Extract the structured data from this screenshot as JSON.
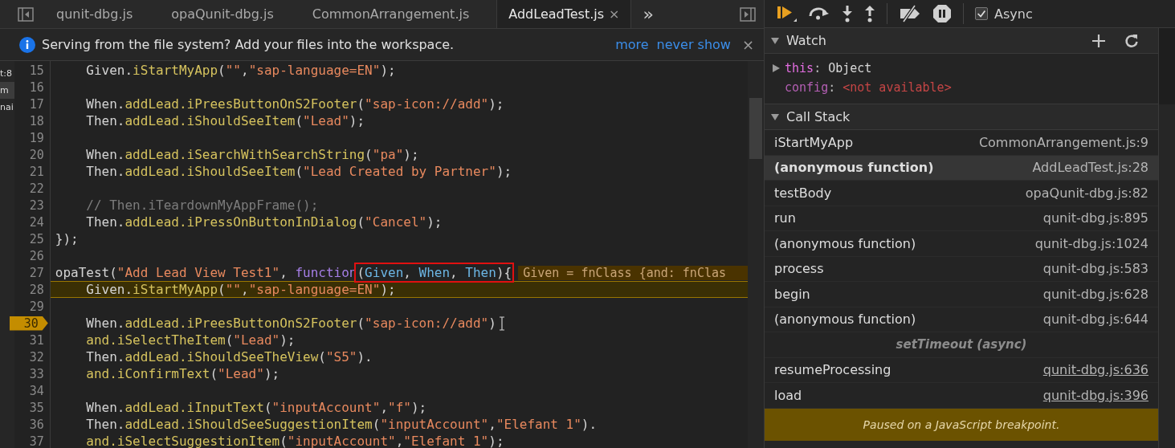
{
  "editor_tabs": [
    {
      "label": "qunit-dbg.js",
      "selected": false
    },
    {
      "label": "opaQunit-dbg.js",
      "selected": false
    },
    {
      "label": "CommonArrangement.js",
      "selected": false
    },
    {
      "label": "AddLeadTest.js",
      "selected": true,
      "close": "×"
    }
  ],
  "tab_overflow": "»",
  "info_bar": {
    "message": "Serving from the file system? Add your files into the workspace.",
    "links": [
      "more",
      "never show"
    ],
    "close": "×"
  },
  "left_panel": [
    {
      "text": "t:8",
      "selected": false
    },
    {
      "text": "m",
      "selected": true
    },
    {
      "text": "nai",
      "selected": false
    }
  ],
  "code_lines": [
    {
      "number": "15",
      "breakpoint": false,
      "current": false,
      "tokens": [
        {
          "kind": "plain",
          "text": "    Given."
        },
        {
          "kind": "method",
          "text": "iStartMyApp"
        },
        {
          "kind": "plain",
          "text": "("
        },
        {
          "kind": "string",
          "text": "\"\""
        },
        {
          "kind": "plain",
          "text": ","
        },
        {
          "kind": "string",
          "text": "\"sap-language=EN\""
        },
        {
          "kind": "plain",
          "text": ");"
        }
      ]
    },
    {
      "number": "16",
      "breakpoint": false,
      "current": false
    },
    {
      "number": "17",
      "breakpoint": false,
      "current": false,
      "tokens": [
        {
          "kind": "plain",
          "text": "    When."
        },
        {
          "kind": "method",
          "text": "addLead.iPreesButtonOnS2Footer"
        },
        {
          "kind": "plain",
          "text": "("
        },
        {
          "kind": "string",
          "text": "\"sap-icon://add\""
        },
        {
          "kind": "plain",
          "text": ");"
        }
      ]
    },
    {
      "number": "18",
      "breakpoint": false,
      "current": false,
      "tokens": [
        {
          "kind": "plain",
          "text": "    Then."
        },
        {
          "kind": "method",
          "text": "addLead.iShouldSeeItem"
        },
        {
          "kind": "plain",
          "text": "("
        },
        {
          "kind": "string",
          "text": "\"Lead\""
        },
        {
          "kind": "plain",
          "text": ");"
        }
      ]
    },
    {
      "number": "19",
      "breakpoint": false,
      "current": false
    },
    {
      "number": "20",
      "breakpoint": false,
      "current": false,
      "tokens": [
        {
          "kind": "plain",
          "text": "    When."
        },
        {
          "kind": "method",
          "text": "addLead.iSearchWithSearchString"
        },
        {
          "kind": "plain",
          "text": "("
        },
        {
          "kind": "string",
          "text": "\"pa\""
        },
        {
          "kind": "plain",
          "text": ");"
        }
      ]
    },
    {
      "number": "21",
      "breakpoint": false,
      "current": false,
      "tokens": [
        {
          "kind": "plain",
          "text": "    Then."
        },
        {
          "kind": "method",
          "text": "addLead.iShouldSeeItem"
        },
        {
          "kind": "plain",
          "text": "("
        },
        {
          "kind": "string",
          "text": "\"Lead Created by Partner\""
        },
        {
          "kind": "plain",
          "text": ");"
        }
      ]
    },
    {
      "number": "22",
      "breakpoint": false,
      "current": false
    },
    {
      "number": "23",
      "breakpoint": false,
      "current": false,
      "tokens": [
        {
          "kind": "comment",
          "text": "    // Then.iTeardownMyAppFrame();"
        }
      ]
    },
    {
      "number": "24",
      "breakpoint": false,
      "current": false,
      "tokens": [
        {
          "kind": "plain",
          "text": "    Then."
        },
        {
          "kind": "method",
          "text": "addLead.iPressOnButtonInDialog"
        },
        {
          "kind": "plain",
          "text": "("
        },
        {
          "kind": "string",
          "text": "\"Cancel\""
        },
        {
          "kind": "plain",
          "text": ");"
        }
      ]
    },
    {
      "number": "25",
      "breakpoint": false,
      "current": false,
      "tokens": [
        {
          "kind": "plain",
          "text": "});"
        }
      ]
    },
    {
      "number": "26",
      "breakpoint": false,
      "current": false
    },
    {
      "number": "27",
      "breakpoint": false,
      "current": false,
      "tokens": [
        {
          "kind": "plain",
          "text": "opaTest("
        },
        {
          "kind": "string",
          "text": "\"Add Lead View Test1\""
        },
        {
          "kind": "plain",
          "text": ", "
        },
        {
          "kind": "keyword",
          "text": "function"
        },
        {
          "kind": "box",
          "children": [
            {
              "kind": "plain",
              "text": "("
            },
            {
              "kind": "param",
              "text": "Given"
            },
            {
              "kind": "plain",
              "text": ", "
            },
            {
              "kind": "param",
              "text": "When"
            },
            {
              "kind": "plain",
              "text": ", "
            },
            {
              "kind": "param",
              "text": "Then"
            },
            {
              "kind": "plain",
              "text": "){"
            }
          ]
        }
      ],
      "inline_value": "Given = fnClass {and: fnClas"
    },
    {
      "number": "28",
      "breakpoint": false,
      "current": true,
      "tokens": [
        {
          "kind": "plain",
          "text": "    Given."
        },
        {
          "kind": "method",
          "text": "iStartMyApp"
        },
        {
          "kind": "plain",
          "text": "("
        },
        {
          "kind": "string",
          "text": "\"\""
        },
        {
          "kind": "plain",
          "text": ","
        },
        {
          "kind": "string",
          "text": "\"sap-language=EN\""
        },
        {
          "kind": "plain",
          "text": ");"
        }
      ]
    },
    {
      "number": "29",
      "breakpoint": false,
      "current": false
    },
    {
      "number": "30",
      "breakpoint": true,
      "current": false,
      "tokens": [
        {
          "kind": "plain",
          "text": "    When."
        },
        {
          "kind": "method",
          "text": "addLead.iPreesButtonOnS2Footer"
        },
        {
          "kind": "plain",
          "text": "("
        },
        {
          "kind": "string",
          "text": "\"sap-icon://add\""
        },
        {
          "kind": "plain",
          "text": ")"
        }
      ]
    },
    {
      "number": "31",
      "breakpoint": false,
      "current": false,
      "tokens": [
        {
          "kind": "method",
          "text": "    and.iSelectTheItem"
        },
        {
          "kind": "plain",
          "text": "("
        },
        {
          "kind": "string",
          "text": "\"Lead\""
        },
        {
          "kind": "plain",
          "text": ");"
        }
      ]
    },
    {
      "number": "32",
      "breakpoint": false,
      "current": false,
      "tokens": [
        {
          "kind": "plain",
          "text": "    Then."
        },
        {
          "kind": "method",
          "text": "addLead.iShouldSeeTheView"
        },
        {
          "kind": "plain",
          "text": "("
        },
        {
          "kind": "string",
          "text": "\"S5\""
        },
        {
          "kind": "plain",
          "text": ")."
        }
      ]
    },
    {
      "number": "33",
      "breakpoint": false,
      "current": false,
      "tokens": [
        {
          "kind": "method",
          "text": "    and.iConfirmText"
        },
        {
          "kind": "plain",
          "text": "("
        },
        {
          "kind": "string",
          "text": "\"Lead\""
        },
        {
          "kind": "plain",
          "text": ");"
        }
      ]
    },
    {
      "number": "34",
      "breakpoint": false,
      "current": false
    },
    {
      "number": "35",
      "breakpoint": false,
      "current": false,
      "tokens": [
        {
          "kind": "plain",
          "text": "    When."
        },
        {
          "kind": "method",
          "text": "addLead.iInputText"
        },
        {
          "kind": "plain",
          "text": "("
        },
        {
          "kind": "string",
          "text": "\"inputAccount\""
        },
        {
          "kind": "plain",
          "text": ","
        },
        {
          "kind": "string",
          "text": "\"f\""
        },
        {
          "kind": "plain",
          "text": ");"
        }
      ]
    },
    {
      "number": "36",
      "breakpoint": false,
      "current": false,
      "tokens": [
        {
          "kind": "plain",
          "text": "    Then."
        },
        {
          "kind": "method",
          "text": "addLead.iShouldSeeSuggestionItem"
        },
        {
          "kind": "plain",
          "text": "("
        },
        {
          "kind": "string",
          "text": "\"inputAccount\""
        },
        {
          "kind": "plain",
          "text": ","
        },
        {
          "kind": "string",
          "text": "\"Elefant 1\""
        },
        {
          "kind": "plain",
          "text": ")."
        }
      ]
    },
    {
      "number": "37",
      "breakpoint": false,
      "current": false,
      "tokens": [
        {
          "kind": "method",
          "text": "    and.iSelectSuggestionItem"
        },
        {
          "kind": "plain",
          "text": "("
        },
        {
          "kind": "string",
          "text": "\"inputAccount\""
        },
        {
          "kind": "plain",
          "text": ","
        },
        {
          "kind": "string",
          "text": "\"Elefant 1\""
        },
        {
          "kind": "plain",
          "text": ");"
        }
      ]
    }
  ],
  "debug_toolbar": {
    "async": {
      "label": "Async",
      "checked": true
    }
  },
  "watch": {
    "title": "Watch",
    "items": [
      {
        "kind": "object",
        "name": "this",
        "separator": ":",
        "value": "Object"
      },
      {
        "kind": "unavailable",
        "name": "config",
        "separator": ":",
        "value": "<not available>"
      }
    ]
  },
  "call_stack": {
    "title": "Call Stack",
    "frames": [
      {
        "kind": "frame",
        "name": "iStartMyApp",
        "location": "CommonArrangement.js:9",
        "selected": false,
        "underlined": false
      },
      {
        "kind": "frame",
        "name": "(anonymous function)",
        "location": "AddLeadTest.js:28",
        "selected": true,
        "underlined": false
      },
      {
        "kind": "frame",
        "name": "testBody",
        "location": "opaQunit-dbg.js:82",
        "selected": false,
        "underlined": false
      },
      {
        "kind": "frame",
        "name": "run",
        "location": "qunit-dbg.js:895",
        "selected": false,
        "underlined": false
      },
      {
        "kind": "frame",
        "name": "(anonymous function)",
        "location": "qunit-dbg.js:1024",
        "selected": false,
        "underlined": false
      },
      {
        "kind": "frame",
        "name": "process",
        "location": "qunit-dbg.js:583",
        "selected": false,
        "underlined": false
      },
      {
        "kind": "frame",
        "name": "begin",
        "location": "qunit-dbg.js:628",
        "selected": false,
        "underlined": false
      },
      {
        "kind": "frame",
        "name": "(anonymous function)",
        "location": "qunit-dbg.js:644",
        "selected": false,
        "underlined": false
      },
      {
        "kind": "async",
        "name": "setTimeout (async)"
      },
      {
        "kind": "frame",
        "name": "resumeProcessing",
        "location": "qunit-dbg.js:636",
        "selected": false,
        "underlined": true
      },
      {
        "kind": "frame",
        "name": "load",
        "location": "qunit-dbg.js:396",
        "selected": false,
        "underlined": true
      }
    ]
  },
  "paused_message": "Paused on a JavaScript breakpoint."
}
